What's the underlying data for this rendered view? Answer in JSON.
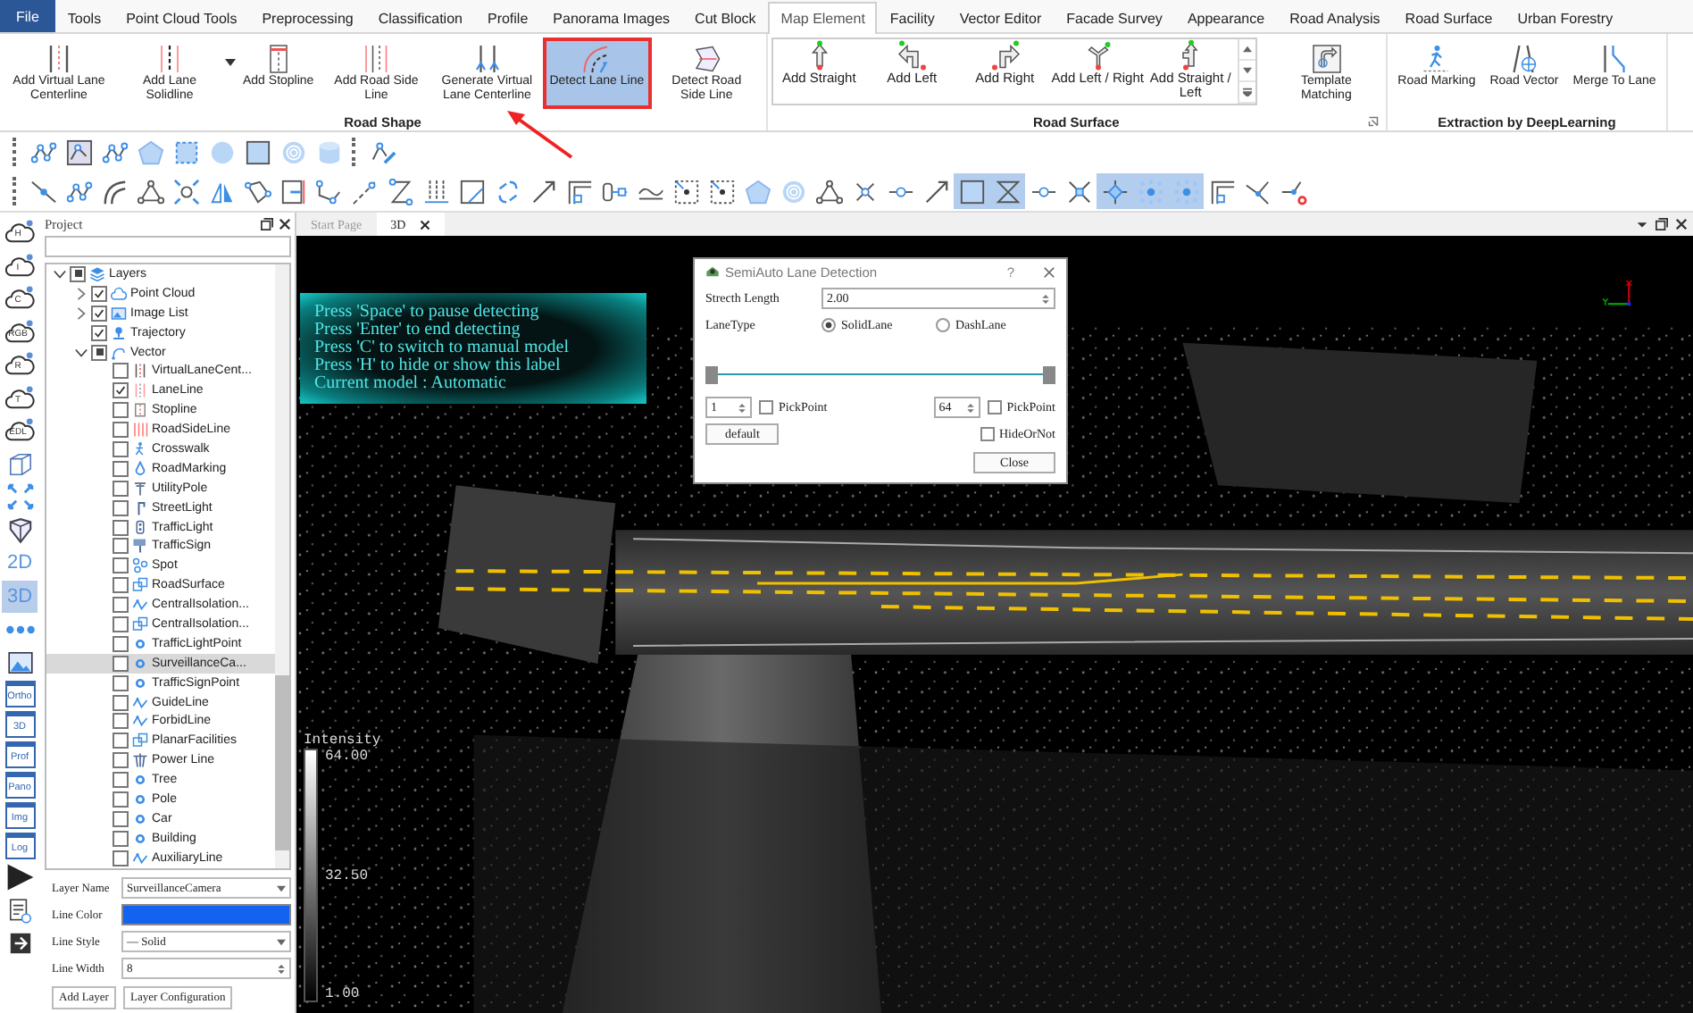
{
  "menu": {
    "file": "File",
    "tabs": [
      {
        "label": "Tools",
        "selected": false
      },
      {
        "label": "Point Cloud Tools",
        "selected": false
      },
      {
        "label": "Preprocessing",
        "selected": false
      },
      {
        "label": "Classification",
        "selected": false
      },
      {
        "label": "Profile",
        "selected": false
      },
      {
        "label": "Panorama Images",
        "selected": false
      },
      {
        "label": "Cut Block",
        "selected": false
      },
      {
        "label": "Map Element",
        "selected": true
      },
      {
        "label": "Facility",
        "selected": false
      },
      {
        "label": "Vector Editor",
        "selected": false
      },
      {
        "label": "Facade Survey",
        "selected": false
      },
      {
        "label": "Appearance",
        "selected": false
      },
      {
        "label": "Road Analysis",
        "selected": false
      },
      {
        "label": "Road Surface",
        "selected": false
      },
      {
        "label": "Urban Forestry",
        "selected": false
      }
    ]
  },
  "ribbon": [
    {
      "title": "Road Shape",
      "launcher": false,
      "items": [
        {
          "kind": "dashed-lines",
          "label": "Add Virtual Lane Centerline",
          "selected": false,
          "dropdown": false
        },
        {
          "kind": "lane-lines",
          "label": "Add Lane Solidline",
          "selected": false,
          "dropdown": true
        },
        {
          "kind": "stop-bar",
          "label": "Add Stopline",
          "selected": false,
          "dropdown": false
        },
        {
          "kind": "road-edges",
          "label": "Add Road Side Line",
          "selected": false,
          "dropdown": false
        },
        {
          "kind": "centerline-arrows",
          "label": "Generate Virtual Lane Centerline",
          "selected": false,
          "dropdown": false
        },
        {
          "kind": "curved-lanes",
          "label": "Detect Lane Line",
          "selected": true,
          "dropdown": false
        },
        {
          "kind": "road-panel",
          "label": "Detect Road Side Line",
          "selected": false,
          "dropdown": false
        }
      ]
    },
    {
      "title": "Road Surface",
      "launcher": true,
      "gallery": [
        {
          "kind": "straight-arrow",
          "label": "Add Straight"
        },
        {
          "kind": "left-arrow",
          "label": "Add Left"
        },
        {
          "kind": "right-arrow",
          "label": "Add Right"
        },
        {
          "kind": "fork-arrow",
          "label": "Add Left / Right"
        },
        {
          "kind": "straight-left-arrow",
          "label": "Add Straight / Left"
        }
      ],
      "items": [
        {
          "kind": "framed-arrow",
          "label": "Template Matching",
          "selected": false,
          "dropdown": false
        }
      ]
    },
    {
      "title": "Extraction by DeepLearning",
      "launcher": false,
      "items": [
        {
          "kind": "pedestrian",
          "label": "Road Marking",
          "selected": false,
          "dropdown": false
        },
        {
          "kind": "road-globe",
          "label": "Road Vector",
          "selected": false,
          "dropdown": false
        },
        {
          "kind": "merge-lines",
          "label": "Merge To Lane",
          "selected": false,
          "dropdown": false
        }
      ]
    }
  ],
  "toolbar_1": [
    {
      "kind": "node-chain",
      "selected": false
    },
    {
      "kind": "framed-nodes",
      "selected": false
    },
    {
      "kind": "node-chain",
      "selected": false
    },
    {
      "kind": "pentagon",
      "selected": false
    },
    {
      "kind": "dashed-square",
      "selected": false
    },
    {
      "kind": "circle",
      "selected": false
    },
    {
      "kind": "square",
      "selected": false
    },
    {
      "kind": "rings",
      "selected": false
    },
    {
      "kind": "cylinder",
      "selected": false
    },
    {
      "kind": "node-pencil",
      "selected": false
    }
  ],
  "toolbar_2": [
    {
      "kind": "line",
      "selected": false
    },
    {
      "kind": "node-chain",
      "selected": false
    },
    {
      "kind": "arc",
      "selected": false
    },
    {
      "kind": "triangle-nodes",
      "selected": false
    },
    {
      "kind": "expand",
      "selected": false
    },
    {
      "kind": "mirror",
      "selected": false
    },
    {
      "kind": "lasso",
      "selected": false
    },
    {
      "kind": "split-rect",
      "selected": false
    },
    {
      "kind": "polyline",
      "selected": false
    },
    {
      "kind": "dashed-line",
      "selected": false
    },
    {
      "kind": "zigzag",
      "selected": false
    },
    {
      "kind": "parallel",
      "selected": false
    },
    {
      "kind": "square-cut",
      "selected": false
    },
    {
      "kind": "loop",
      "selected": false
    },
    {
      "kind": "arrow-line",
      "selected": false
    },
    {
      "kind": "corner",
      "selected": false
    },
    {
      "kind": "slider-nodes",
      "selected": false
    },
    {
      "kind": "wave",
      "selected": false
    },
    {
      "kind": "dot-square",
      "selected": false
    },
    {
      "kind": "dot-square",
      "selected": false
    },
    {
      "kind": "pentagon",
      "selected": false
    },
    {
      "kind": "rings",
      "selected": false
    },
    {
      "kind": "triangle-nodes",
      "selected": false
    },
    {
      "kind": "cross-nodes",
      "selected": false
    },
    {
      "kind": "node-line",
      "selected": false
    },
    {
      "kind": "arrow-line",
      "selected": false
    },
    {
      "kind": "square",
      "selected": true
    },
    {
      "kind": "hourglass",
      "selected": true
    },
    {
      "kind": "node-line",
      "selected": false
    },
    {
      "kind": "cross",
      "selected": false
    },
    {
      "kind": "diamond",
      "selected": true
    },
    {
      "kind": "dot-grid",
      "selected": true
    },
    {
      "kind": "dot-grid",
      "selected": true
    },
    {
      "kind": "corner",
      "selected": false
    },
    {
      "kind": "angle",
      "selected": false
    },
    {
      "kind": "angle-dot",
      "selected": false
    }
  ],
  "strip": [
    {
      "kind": "cloud",
      "label": "H",
      "selected": false
    },
    {
      "kind": "cloud",
      "label": "I",
      "selected": false
    },
    {
      "kind": "cloud",
      "label": "C",
      "selected": false
    },
    {
      "kind": "cloud",
      "label": "RGB",
      "selected": false
    },
    {
      "kind": "cloud",
      "label": "R",
      "selected": false
    },
    {
      "kind": "cloud",
      "label": "T",
      "selected": false
    },
    {
      "kind": "cloud",
      "label": "EDL",
      "selected": false
    },
    {
      "kind": "cube",
      "selected": false
    },
    {
      "kind": "expand",
      "selected": false
    },
    {
      "kind": "viewcube",
      "selected": false
    },
    {
      "kind": "text",
      "label": "2D",
      "selected": false
    },
    {
      "kind": "text",
      "label": "3D",
      "selected": true
    },
    {
      "kind": "dots",
      "selected": false
    },
    {
      "kind": "picture",
      "selected": false
    },
    {
      "kind": "window",
      "label": "Ortho",
      "selected": false
    },
    {
      "kind": "window",
      "label": "3D",
      "selected": false
    },
    {
      "kind": "window",
      "label": "Prof",
      "selected": false
    },
    {
      "kind": "window",
      "label": "Pano",
      "selected": false
    },
    {
      "kind": "window",
      "label": "Img",
      "selected": false
    },
    {
      "kind": "window",
      "label": "Log",
      "selected": false
    },
    {
      "kind": "play",
      "selected": false
    },
    {
      "kind": "report",
      "selected": false
    },
    {
      "kind": "export",
      "selected": false
    }
  ],
  "project": {
    "title": "Project"
  },
  "tree": [
    {
      "label": "Layers",
      "kind": "layers",
      "expanded": true,
      "checked": false,
      "partial": true,
      "selected": false,
      "children": [
        {
          "label": "Point Cloud",
          "kind": "cloud",
          "expanded": false,
          "checked": true,
          "partial": false,
          "selected": false
        },
        {
          "label": "Image List",
          "kind": "image",
          "expanded": false,
          "checked": true,
          "partial": false,
          "selected": false
        },
        {
          "label": "Trajectory",
          "kind": "pin",
          "checked": true,
          "partial": false,
          "selected": false
        },
        {
          "label": "Vector",
          "kind": "curve",
          "expanded": true,
          "checked": false,
          "partial": true,
          "selected": false,
          "children": [
            {
              "label": "VirtualLaneCent...",
              "kind": "dashed-lines",
              "checked": false,
              "partial": false,
              "selected": false
            },
            {
              "label": "LaneLine",
              "kind": "lane-lines",
              "checked": true,
              "partial": false,
              "selected": false
            },
            {
              "label": "Stopline",
              "kind": "stop-bar",
              "checked": false,
              "partial": false,
              "selected": false
            },
            {
              "label": "RoadSideLine",
              "kind": "road-edges",
              "checked": false,
              "partial": false,
              "selected": false
            },
            {
              "label": "Crosswalk",
              "kind": "walker",
              "checked": false,
              "partial": false,
              "selected": false
            },
            {
              "label": "RoadMarking",
              "kind": "drop",
              "checked": false,
              "partial": false,
              "selected": false
            },
            {
              "label": "UtilityPole",
              "kind": "pole",
              "checked": false,
              "partial": false,
              "selected": false
            },
            {
              "label": "StreetLight",
              "kind": "lamp",
              "checked": false,
              "partial": false,
              "selected": false
            },
            {
              "label": "TrafficLight",
              "kind": "signal",
              "checked": false,
              "partial": false,
              "selected": false
            },
            {
              "label": "TrafficSign",
              "kind": "sign",
              "checked": false,
              "partial": false,
              "selected": false
            },
            {
              "label": "Spot",
              "kind": "dots",
              "checked": false,
              "partial": false,
              "selected": false
            },
            {
              "label": "RoadSurface",
              "kind": "squares",
              "checked": false,
              "partial": false,
              "selected": false
            },
            {
              "label": "CentralIsolation...",
              "kind": "wave",
              "checked": false,
              "partial": false,
              "selected": false
            },
            {
              "label": "CentralIsolation...",
              "kind": "squares",
              "checked": false,
              "partial": false,
              "selected": false
            },
            {
              "label": "TrafficLightPoint",
              "kind": "ring",
              "checked": false,
              "partial": false,
              "selected": false
            },
            {
              "label": "SurveillanceCa...",
              "kind": "ring",
              "checked": false,
              "partial": false,
              "selected": true
            },
            {
              "label": "TrafficSignPoint",
              "kind": "ring",
              "checked": false,
              "partial": false,
              "selected": false
            },
            {
              "label": "GuideLine",
              "kind": "wave",
              "checked": false,
              "partial": false,
              "selected": false
            },
            {
              "label": "ForbidLine",
              "kind": "wave",
              "checked": false,
              "partial": false,
              "selected": false
            },
            {
              "label": "PlanarFacilities",
              "kind": "squares",
              "checked": false,
              "partial": false,
              "selected": false
            },
            {
              "label": "Power Line",
              "kind": "tower",
              "checked": false,
              "partial": false,
              "selected": false
            },
            {
              "label": "Tree",
              "kind": "ring",
              "checked": false,
              "partial": false,
              "selected": false
            },
            {
              "label": "Pole",
              "kind": "ring",
              "checked": false,
              "partial": false,
              "selected": false
            },
            {
              "label": "Car",
              "kind": "ring",
              "checked": false,
              "partial": false,
              "selected": false
            },
            {
              "label": "Building",
              "kind": "ring",
              "checked": false,
              "partial": false,
              "selected": false
            },
            {
              "label": "AuxiliaryLine",
              "kind": "wave",
              "checked": false,
              "partial": false,
              "selected": false
            }
          ]
        }
      ]
    }
  ],
  "properties": {
    "layer_name": {
      "label": "Layer Name",
      "value": "SurveillanceCamera"
    },
    "line_color": {
      "label": "Line Color",
      "color": "#1463f0"
    },
    "line_style": {
      "label": "Line Style",
      "value": "— Solid"
    },
    "line_width": {
      "label": "Line Width",
      "value": "8"
    },
    "buttons": [
      "Add Layer",
      "Layer Configuration"
    ]
  },
  "view_tabs": [
    {
      "label": "Start Page",
      "selected": false,
      "closable": false
    },
    {
      "label": "3D",
      "selected": true,
      "closable": true
    }
  ],
  "hint_lines": [
    "Press 'Space' to pause detecting",
    "Press 'Enter' to end detecting",
    "Press 'C' to switch to manual model",
    "Press 'H' to hide or show this label",
    "Current model : Automatic"
  ],
  "legend": {
    "title": "Intensity",
    "ticks": [
      "64.00",
      "32.50",
      "1.00"
    ]
  },
  "dialog": {
    "title": "SemiAuto Lane Detection",
    "help": "?",
    "stretch": {
      "label": "Strecth Length",
      "value": "2.00"
    },
    "lane_type": {
      "label": "LaneType",
      "options": [
        {
          "label": "SolidLane",
          "selected": true
        },
        {
          "label": "DashLane",
          "selected": false
        }
      ]
    },
    "range": [
      {
        "level": 0
      },
      {
        "level": 1
      }
    ],
    "spins": [
      {
        "value": "1",
        "pick": {
          "label": "PickPoint",
          "checked": false
        }
      },
      {
        "value": "64",
        "pick": {
          "label": "PickPoint",
          "checked": false
        }
      }
    ],
    "default_button": "default",
    "hide": {
      "label": "HideOrNot",
      "checked": false
    },
    "close_button": "Close"
  }
}
